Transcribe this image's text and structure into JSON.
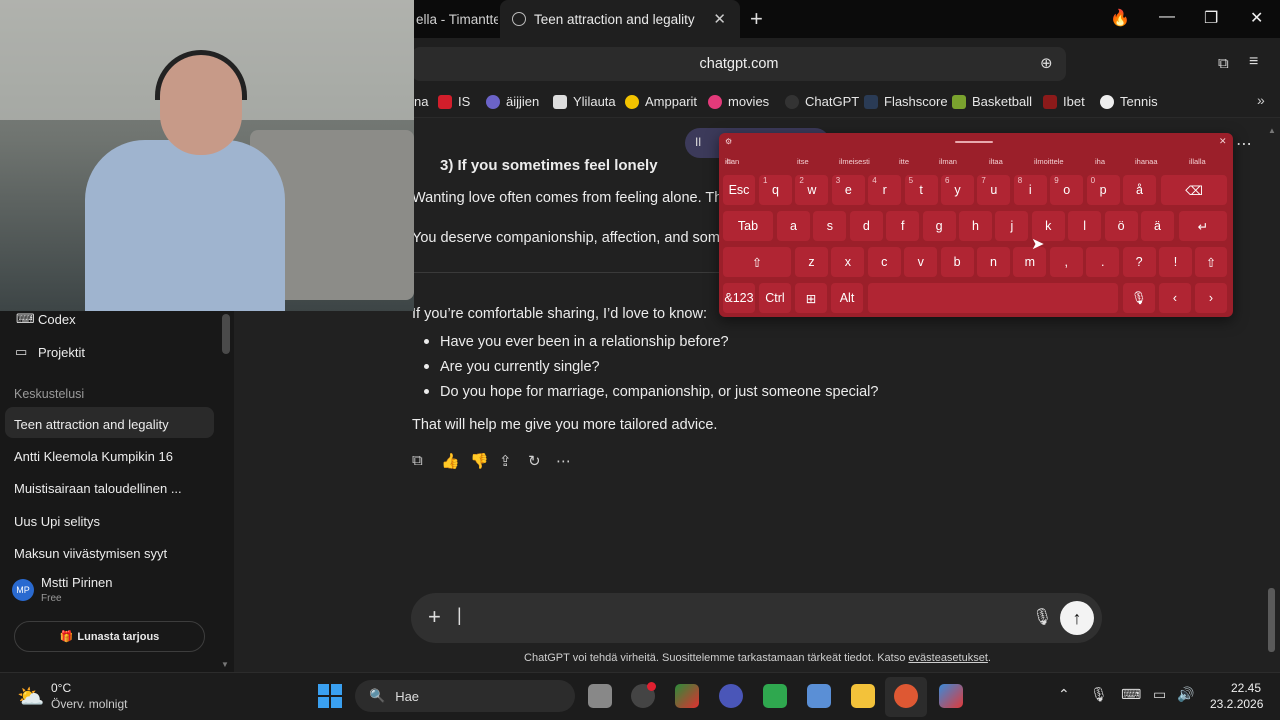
{
  "browser": {
    "prev_tab": "ella - Timanttei",
    "active_tab": "Teen attraction and legality",
    "new_tab": "+",
    "close_tab": "✕",
    "address": "chatgpt.com",
    "bookmarks": [
      {
        "label": "na"
      },
      {
        "label": "IS"
      },
      {
        "label": "äijjien"
      },
      {
        "label": "Ylilauta"
      },
      {
        "label": "Ampparit"
      },
      {
        "label": "movies"
      },
      {
        "label": "ChatGPT"
      },
      {
        "label": "Flashscore"
      },
      {
        "label": "Basketball"
      },
      {
        "label": "Ibet"
      },
      {
        "label": "Tennis"
      }
    ]
  },
  "sidebar": {
    "codex": "Codex",
    "projects": "Projektit",
    "section": "Keskustelusi",
    "chats": [
      "Teen attraction and legality",
      "Antti Kleemola Kumpikin 16",
      "Muistisairaan taloudellinen ...",
      "Uus Upi selitys",
      "Maksun viivästymisen syyt"
    ],
    "user": {
      "initials": "MP",
      "name": "Mstti Pirinen",
      "plan": "Free"
    },
    "offer": "Lunasta tarjous"
  },
  "chat": {
    "heading": "3) If you sometimes feel lonely",
    "p1": "Wanting love often comes from feeling alone. Th",
    "p2": "You deserve companionship, affection, and some",
    "ask": "If you’re comfortable sharing, I’d love to know:",
    "bullets": [
      "Have you ever been in a relationship before?",
      "Are you currently single?",
      "Do you hope for marriage, companionship, or just someone special?"
    ],
    "closing": "That will help me give you more tailored advice.",
    "pill": "Il",
    "composer_plus": "+",
    "composer_cursor": "|",
    "disclaimer": "ChatGPT voi tehdä virheitä. Suosittelemme tarkastamaan tärkeät tiedot. Katso ",
    "disclaimer_link": "evästeasetukset",
    "disclaimer_end": "."
  },
  "keyboard": {
    "suggestions": [
      "ihan",
      "itse",
      "ilmeisesti",
      "itte",
      "ilman",
      "iltaa",
      "ilmoittele",
      "iha",
      "ihanaa",
      "illalla"
    ],
    "row1": [
      {
        "k": "Esc",
        "s": ""
      },
      {
        "k": "q",
        "s": "1"
      },
      {
        "k": "w",
        "s": "2"
      },
      {
        "k": "e",
        "s": "3"
      },
      {
        "k": "r",
        "s": "4"
      },
      {
        "k": "t",
        "s": "5"
      },
      {
        "k": "y",
        "s": "6"
      },
      {
        "k": "u",
        "s": "7"
      },
      {
        "k": "i",
        "s": "8"
      },
      {
        "k": "o",
        "s": "9"
      },
      {
        "k": "p",
        "s": "0"
      },
      {
        "k": "å",
        "s": ""
      },
      {
        "k": "⌫",
        "s": ""
      }
    ],
    "row2": [
      "Tab",
      "a",
      "s",
      "d",
      "f",
      "g",
      "h",
      "j",
      "k",
      "l",
      "ö",
      "ä",
      "↵"
    ],
    "row3": [
      "⇧",
      "z",
      "x",
      "c",
      "v",
      "b",
      "n",
      "m",
      ",",
      ".",
      "?",
      "!",
      "⇧"
    ],
    "row4": [
      "&123",
      "Ctrl",
      "⊞",
      "Alt",
      "",
      "🎙",
      "‹",
      "›"
    ]
  },
  "taskbar": {
    "temp": "0°C",
    "weather": "Överv. molnigt",
    "search": "Hae",
    "time": "22.45",
    "date": "23.2.2026"
  },
  "colors": {
    "accent": "#9b1f2a",
    "bg": "#212121",
    "sidebar": "#181818"
  }
}
